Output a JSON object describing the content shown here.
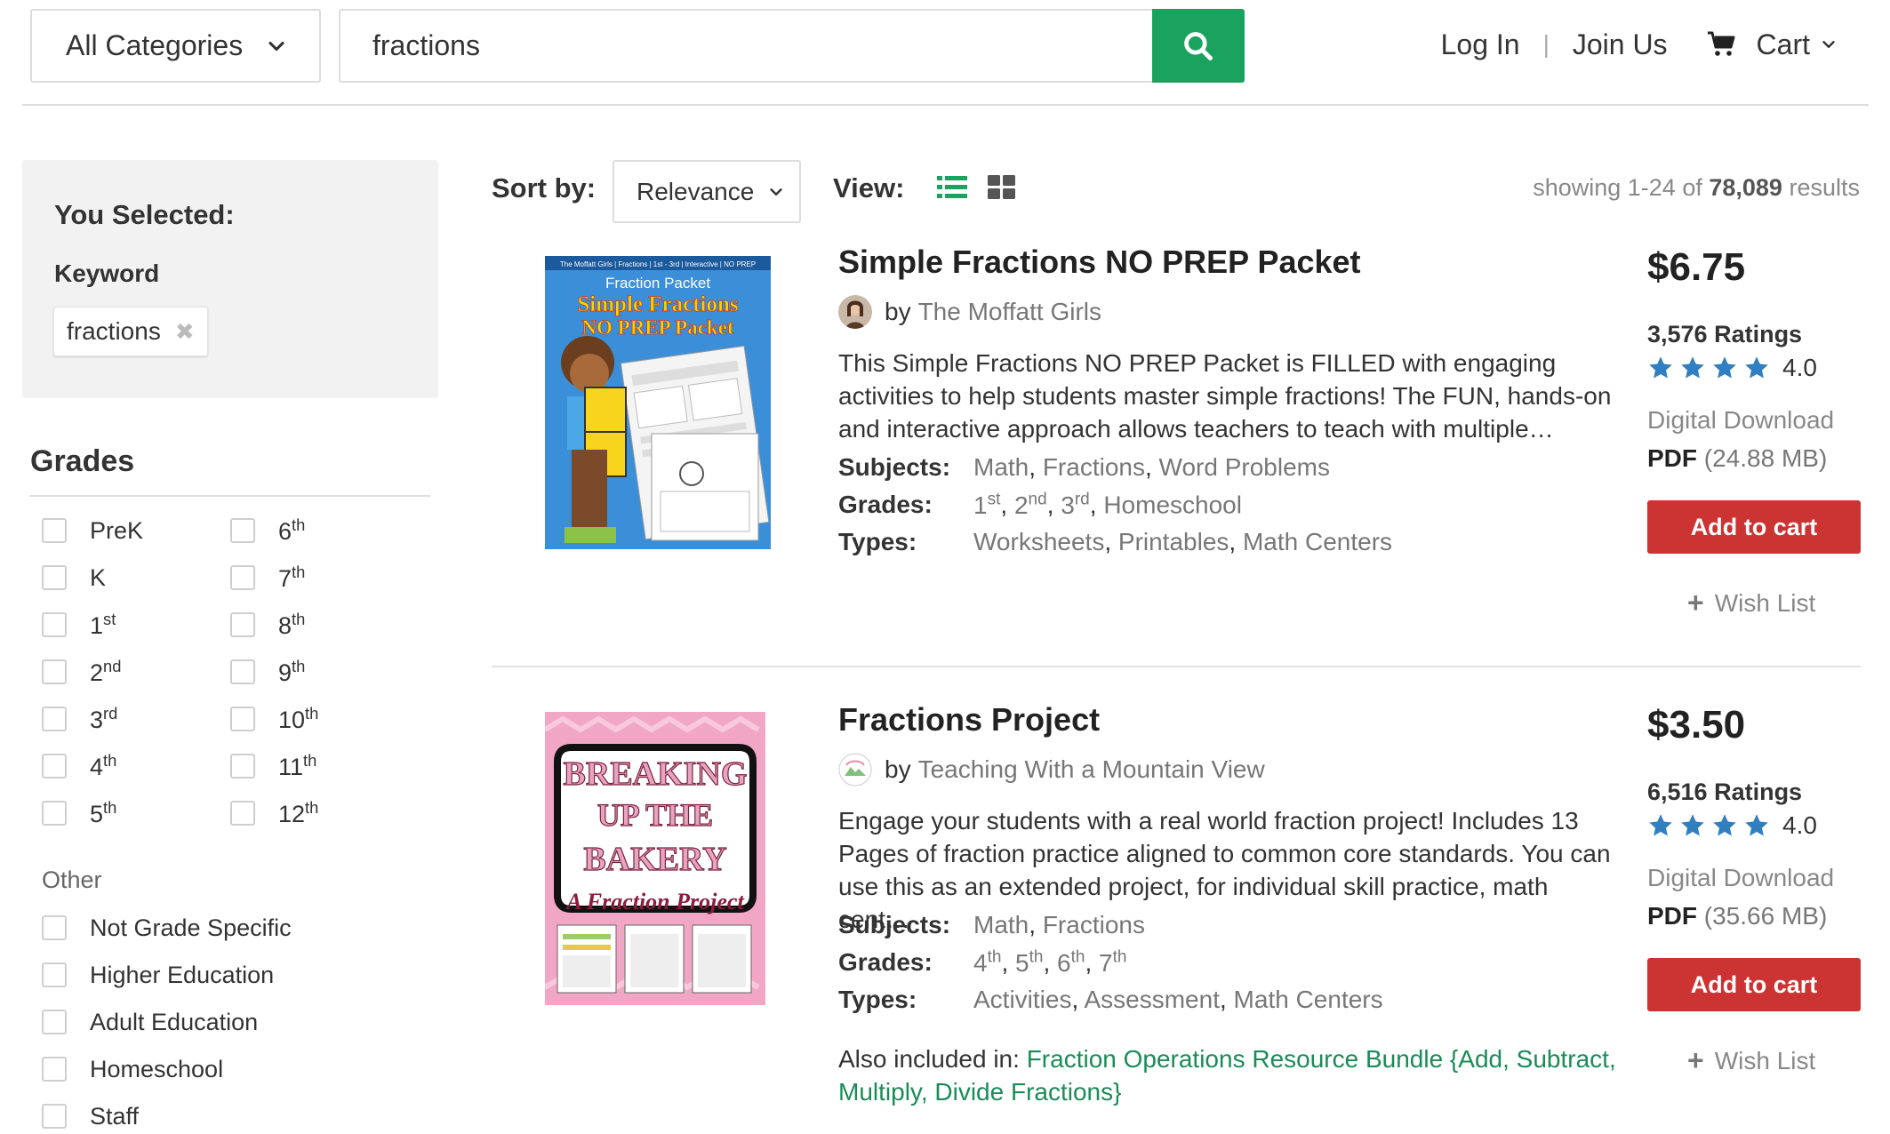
{
  "header": {
    "category_label": "All Categories",
    "search_value": "fractions",
    "login": "Log In",
    "separator": "|",
    "join": "Join Us",
    "cart": "Cart"
  },
  "sidebar": {
    "selected_title": "You Selected:",
    "keyword_label": "Keyword",
    "keyword_chip": "fractions",
    "chip_remove": "✖",
    "grades_title": "Grades",
    "grades_left": [
      {
        "base": "PreK",
        "sup": ""
      },
      {
        "base": "K",
        "sup": ""
      },
      {
        "base": "1",
        "sup": "st"
      },
      {
        "base": "2",
        "sup": "nd"
      },
      {
        "base": "3",
        "sup": "rd"
      },
      {
        "base": "4",
        "sup": "th"
      },
      {
        "base": "5",
        "sup": "th"
      }
    ],
    "grades_right": [
      {
        "base": "6",
        "sup": "th"
      },
      {
        "base": "7",
        "sup": "th"
      },
      {
        "base": "8",
        "sup": "th"
      },
      {
        "base": "9",
        "sup": "th"
      },
      {
        "base": "10",
        "sup": "th"
      },
      {
        "base": "11",
        "sup": "th"
      },
      {
        "base": "12",
        "sup": "th"
      }
    ],
    "other_label": "Other",
    "other_items": [
      "Not Grade Specific",
      "Higher Education",
      "Adult Education",
      "Homeschool",
      "Staff"
    ]
  },
  "toolbar": {
    "sort_label": "Sort by:",
    "sort_value": "Relevance",
    "view_label": "View:",
    "results_prefix": "showing 1-24 of",
    "results_count": "78,089",
    "results_suffix": "results"
  },
  "products": [
    {
      "title": "Simple Fractions NO PREP Packet",
      "by": "by",
      "author": "The Moffatt Girls",
      "description": "This Simple Fractions NO PREP Packet is FILLED with engaging activities to help students master simple fractions! The FUN, hands-on and interactive approach allows teachers to teach with multiple…",
      "subjects_label": "Subjects:",
      "subjects": [
        "Math",
        "Fractions",
        "Word Problems"
      ],
      "grades_label": "Grades:",
      "grades": [
        {
          "base": "1",
          "sup": "st"
        },
        {
          "base": "2",
          "sup": "nd"
        },
        {
          "base": "3",
          "sup": "rd"
        },
        {
          "base": "Homeschool",
          "sup": ""
        }
      ],
      "types_label": "Types:",
      "types": [
        "Worksheets",
        "Printables",
        "Math Centers"
      ],
      "price": "$6.75",
      "ratings": "3,576 Ratings",
      "score": "4.0",
      "stars": 4,
      "delivery": "Digital Download",
      "format": "PDF",
      "size": "(24.88 MB)",
      "add_to_cart": "Add to cart",
      "wish_list": "Wish List",
      "cover_lines": [
        "Fraction Packet",
        "Simple Fractions",
        "NO PREP Packet"
      ],
      "cover_tag": "The Moffatt Girls  |  Fractions  |  1st - 3rd  |  Interactive  |  NO PREP"
    },
    {
      "title": "Fractions Project",
      "by": "by",
      "author": "Teaching With a Mountain View",
      "description": "Engage your students with a real world fraction project! Includes 13 Pages of fraction practice aligned to common core standards. You can use this as an extended project, for individual skill practice, math cent…",
      "subjects_label": "Subjects:",
      "subjects": [
        "Math",
        "Fractions"
      ],
      "grades_label": "Grades:",
      "grades": [
        {
          "base": "4",
          "sup": "th"
        },
        {
          "base": "5",
          "sup": "th"
        },
        {
          "base": "6",
          "sup": "th"
        },
        {
          "base": "7",
          "sup": "th"
        }
      ],
      "types_label": "Types:",
      "types": [
        "Activities",
        "Assessment",
        "Math Centers"
      ],
      "also_label": "Also included in:",
      "also_link": "Fraction Operations Resource Bundle {Add, Subtract, Multiply, Divide Fractions}",
      "price": "$3.50",
      "ratings": "6,516 Ratings",
      "score": "4.0",
      "stars": 4,
      "delivery": "Digital Download",
      "format": "PDF",
      "size": "(35.66 MB)",
      "add_to_cart": "Add to cart",
      "wish_list": "Wish List",
      "cover_lines": [
        "BREAKING",
        "UP THE",
        "BAKERY",
        "A Fraction Project"
      ]
    }
  ],
  "colors": {
    "accent_green": "#1aa35f",
    "add_to_cart_red": "#cc3333",
    "star_blue": "#2f7fc1",
    "link_green": "#1a8c57"
  }
}
